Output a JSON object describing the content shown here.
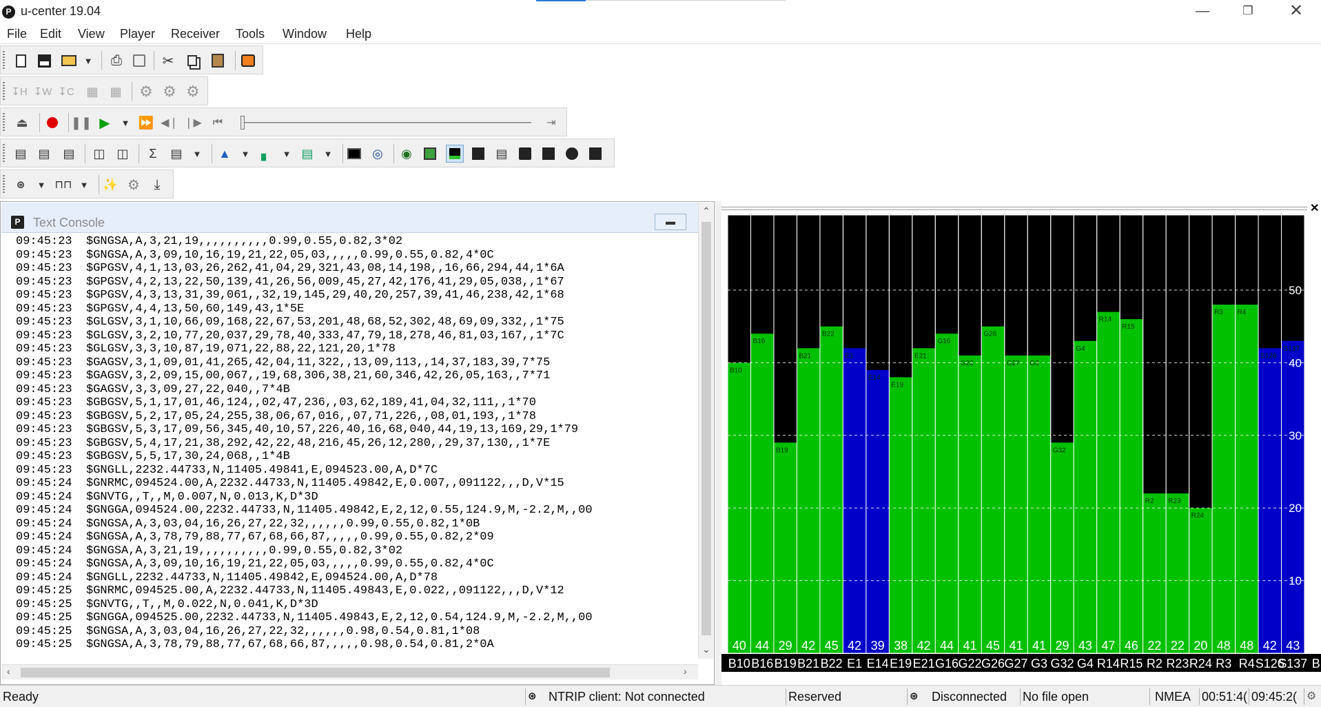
{
  "window": {
    "title": "u-center 19.04",
    "logo": "P"
  },
  "menu": [
    "File",
    "Edit",
    "View",
    "Player",
    "Receiver",
    "Tools",
    "Window",
    "Help"
  ],
  "console": {
    "title": "Text Console",
    "lines": [
      "09:45:23  $GNGSA,A,3,21,19,,,,,,,,,,0.99,0.55,0.82,3*02",
      "09:45:23  $GNGSA,A,3,09,10,16,19,21,22,05,03,,,,,0.99,0.55,0.82,4*0C",
      "09:45:23  $GPGSV,4,1,13,03,26,262,41,04,29,321,43,08,14,198,,16,66,294,44,1*6A",
      "09:45:23  $GPGSV,4,2,13,22,50,139,41,26,56,009,45,27,42,176,41,29,05,038,,1*67",
      "09:45:23  $GPGSV,4,3,13,31,39,061,,32,19,145,29,40,20,257,39,41,46,238,42,1*68",
      "09:45:23  $GPGSV,4,4,13,50,60,149,43,1*5E",
      "09:45:23  $GLGSV,3,1,10,66,09,168,22,67,53,201,48,68,52,302,48,69,09,332,,1*75",
      "09:45:23  $GLGSV,3,2,10,77,20,037,29,78,40,333,47,79,18,278,46,81,03,167,,1*7C",
      "09:45:23  $GLGSV,3,3,10,87,19,071,22,88,22,121,20,1*78",
      "09:45:23  $GAGSV,3,1,09,01,41,265,42,04,11,322,,13,09,113,,14,37,183,39,7*75",
      "09:45:23  $GAGSV,3,2,09,15,00,067,,19,68,306,38,21,60,346,42,26,05,163,,7*71",
      "09:45:23  $GAGSV,3,3,09,27,22,040,,7*4B",
      "09:45:23  $GBGSV,5,1,17,01,46,124,,02,47,236,,03,62,189,41,04,32,111,,1*70",
      "09:45:23  $GBGSV,5,2,17,05,24,255,38,06,67,016,,07,71,226,,08,01,193,,1*78",
      "09:45:23  $GBGSV,5,3,17,09,56,345,40,10,57,226,40,16,68,040,44,19,13,169,29,1*79",
      "09:45:23  $GBGSV,5,4,17,21,38,292,42,22,48,216,45,26,12,280,,29,37,130,,1*7E",
      "09:45:23  $GBGSV,5,5,17,30,24,068,,1*4B",
      "09:45:23  $GNGLL,2232.44733,N,11405.49841,E,094523.00,A,D*7C",
      "09:45:24  $GNRMC,094524.00,A,2232.44733,N,11405.49842,E,0.007,,091122,,,D,V*15",
      "09:45:24  $GNVTG,,T,,M,0.007,N,0.013,K,D*3D",
      "09:45:24  $GNGGA,094524.00,2232.44733,N,11405.49842,E,2,12,0.55,124.9,M,-2.2,M,,00",
      "09:45:24  $GNGSA,A,3,03,04,16,26,27,22,32,,,,,,0.99,0.55,0.82,1*0B",
      "09:45:24  $GNGSA,A,3,78,79,88,77,67,68,66,87,,,,,0.99,0.55,0.82,2*09",
      "09:45:24  $GNGSA,A,3,21,19,,,,,,,,,,0.99,0.55,0.82,3*02",
      "09:45:24  $GNGSA,A,3,09,10,16,19,21,22,05,03,,,,,0.99,0.55,0.82,4*0C",
      "09:45:24  $GNGLL,2232.44733,N,11405.49842,E,094524.00,A,D*78",
      "09:45:25  $GNRMC,094525.00,A,2232.44733,N,11405.49843,E,0.022,,091122,,,D,V*12",
      "09:45:25  $GNVTG,,T,,M,0.022,N,0.041,K,D*3D",
      "09:45:25  $GNGGA,094525.00,2232.44733,N,11405.49843,E,2,12,0.54,124.9,M,-2.2,M,,00",
      "09:45:25  $GNGSA,A,3,03,04,16,26,27,22,32,,,,,,0.98,0.54,0.81,1*08",
      "09:45:25  $GNGSA,A,3,78,79,88,77,67,68,66,87,,,,,0.98,0.54,0.81,2*0A"
    ]
  },
  "chart_data": {
    "type": "bar",
    "ylim": [
      0,
      50
    ],
    "yticks": [
      "10",
      "20",
      "30",
      "40",
      "50"
    ],
    "categories": [
      "B10",
      "B16",
      "B19",
      "B21",
      "B22",
      "E1",
      "E14",
      "E19",
      "E21",
      "G16",
      "G22",
      "G26",
      "G27",
      "G3",
      "G32",
      "G4",
      "R14",
      "R15",
      "R2",
      "R23",
      "R24",
      "R3",
      "R4",
      "S126",
      "S137"
    ],
    "bottom_labels": [
      "B10",
      "B16",
      "B19",
      "B21",
      "B22",
      "E1",
      "E14",
      "E19",
      "E21",
      "G16",
      "G22",
      "G26",
      "G27",
      "G3",
      "G32",
      "G4",
      "R14",
      "R15",
      "R2",
      "R23",
      "R24",
      "R3",
      "R4",
      "S126",
      "S137",
      "B"
    ],
    "values": [
      40,
      44,
      29,
      42,
      45,
      42,
      39,
      38,
      42,
      44,
      41,
      45,
      41,
      41,
      29,
      43,
      47,
      46,
      22,
      22,
      20,
      48,
      48,
      42,
      43
    ],
    "value_labels": [
      "40",
      "44",
      "29",
      "42",
      "45",
      "42",
      "39",
      "38",
      "42",
      "44",
      "41",
      "45",
      "41",
      "41",
      "29",
      "43",
      "47",
      "46",
      "22",
      "22",
      "20",
      "48",
      "48",
      "42",
      "43"
    ],
    "colors": [
      "green",
      "green",
      "green",
      "green",
      "green",
      "blue",
      "blue",
      "green",
      "green",
      "green",
      "green",
      "green",
      "green",
      "green",
      "green",
      "green",
      "green",
      "green",
      "green",
      "green",
      "green",
      "green",
      "green",
      "blue",
      "blue"
    ],
    "palette": {
      "green": "#00c000",
      "blue": "#0000c8",
      "background": "#000000"
    },
    "grid": true
  },
  "status": {
    "ready": "Ready",
    "ntrip": "NTRIP client: Not connected",
    "reserved": "Reserved",
    "connection": "Disconnected",
    "file": "No file open",
    "protocol": "NMEA",
    "elapsed": "00:51:4(",
    "time": "09:45:2("
  }
}
